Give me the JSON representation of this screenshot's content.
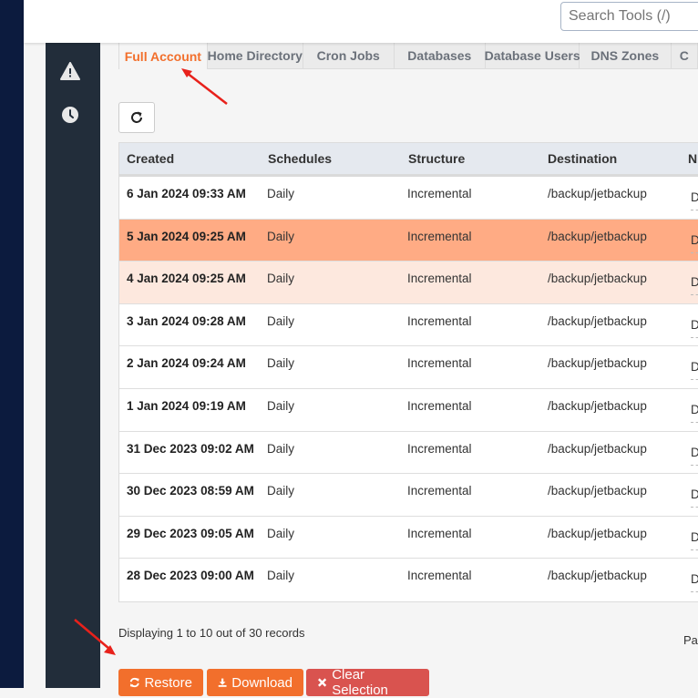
{
  "header": {
    "search_placeholder": "Search Tools (/)"
  },
  "sidebar": {
    "icons": [
      "warning-icon",
      "clock-icon"
    ]
  },
  "tabs": [
    {
      "label": "Full Account",
      "active": true
    },
    {
      "label": "Home Directory",
      "active": false
    },
    {
      "label": "Cron Jobs",
      "active": false
    },
    {
      "label": "Databases",
      "active": false
    },
    {
      "label": "Database Users",
      "active": false
    },
    {
      "label": "DNS Zones",
      "active": false
    },
    {
      "label": "C",
      "active": false
    }
  ],
  "table": {
    "columns": [
      "Created",
      "Schedules",
      "Structure",
      "Destination",
      "N"
    ],
    "rows": [
      {
        "created": "6 Jan 2024 09:33 AM",
        "schedules": "Daily",
        "structure": "Incremental",
        "destination": "/backup/jetbackup",
        "notes": "D",
        "state": "normal"
      },
      {
        "created": "5 Jan 2024 09:25 AM",
        "schedules": "Daily",
        "structure": "Incremental",
        "destination": "/backup/jetbackup",
        "notes": "D",
        "state": "selected"
      },
      {
        "created": "4 Jan 2024 09:25 AM",
        "schedules": "Daily",
        "structure": "Incremental",
        "destination": "/backup/jetbackup",
        "notes": "D",
        "state": "hover"
      },
      {
        "created": "3 Jan 2024 09:28 AM",
        "schedules": "Daily",
        "structure": "Incremental",
        "destination": "/backup/jetbackup",
        "notes": "D",
        "state": "normal"
      },
      {
        "created": "2 Jan 2024 09:24 AM",
        "schedules": "Daily",
        "structure": "Incremental",
        "destination": "/backup/jetbackup",
        "notes": "D",
        "state": "normal"
      },
      {
        "created": "1 Jan 2024 09:19 AM",
        "schedules": "Daily",
        "structure": "Incremental",
        "destination": "/backup/jetbackup",
        "notes": "D",
        "state": "normal"
      },
      {
        "created": "31 Dec 2023 09:02 AM",
        "schedules": "Daily",
        "structure": "Incremental",
        "destination": "/backup/jetbackup",
        "notes": "D",
        "state": "normal"
      },
      {
        "created": "30 Dec 2023 08:59 AM",
        "schedules": "Daily",
        "structure": "Incremental",
        "destination": "/backup/jetbackup",
        "notes": "D",
        "state": "normal"
      },
      {
        "created": "29 Dec 2023 09:05 AM",
        "schedules": "Daily",
        "structure": "Incremental",
        "destination": "/backup/jetbackup",
        "notes": "D",
        "state": "normal"
      },
      {
        "created": "28 Dec 2023 09:00 AM",
        "schedules": "Daily",
        "structure": "Incremental",
        "destination": "/backup/jetbackup",
        "notes": "D",
        "state": "normal"
      }
    ]
  },
  "footer": {
    "records_text": "Displaying 1 to 10 out of 30 records",
    "pagination_label": "Pa"
  },
  "actions": {
    "restore_label": "Restore",
    "download_label": "Download",
    "clear_label": "Clear Selection"
  },
  "colors": {
    "accent": "#f26f2c",
    "danger": "#d9534f",
    "selected_row": "#ffab84",
    "hover_row": "#fde8de"
  }
}
